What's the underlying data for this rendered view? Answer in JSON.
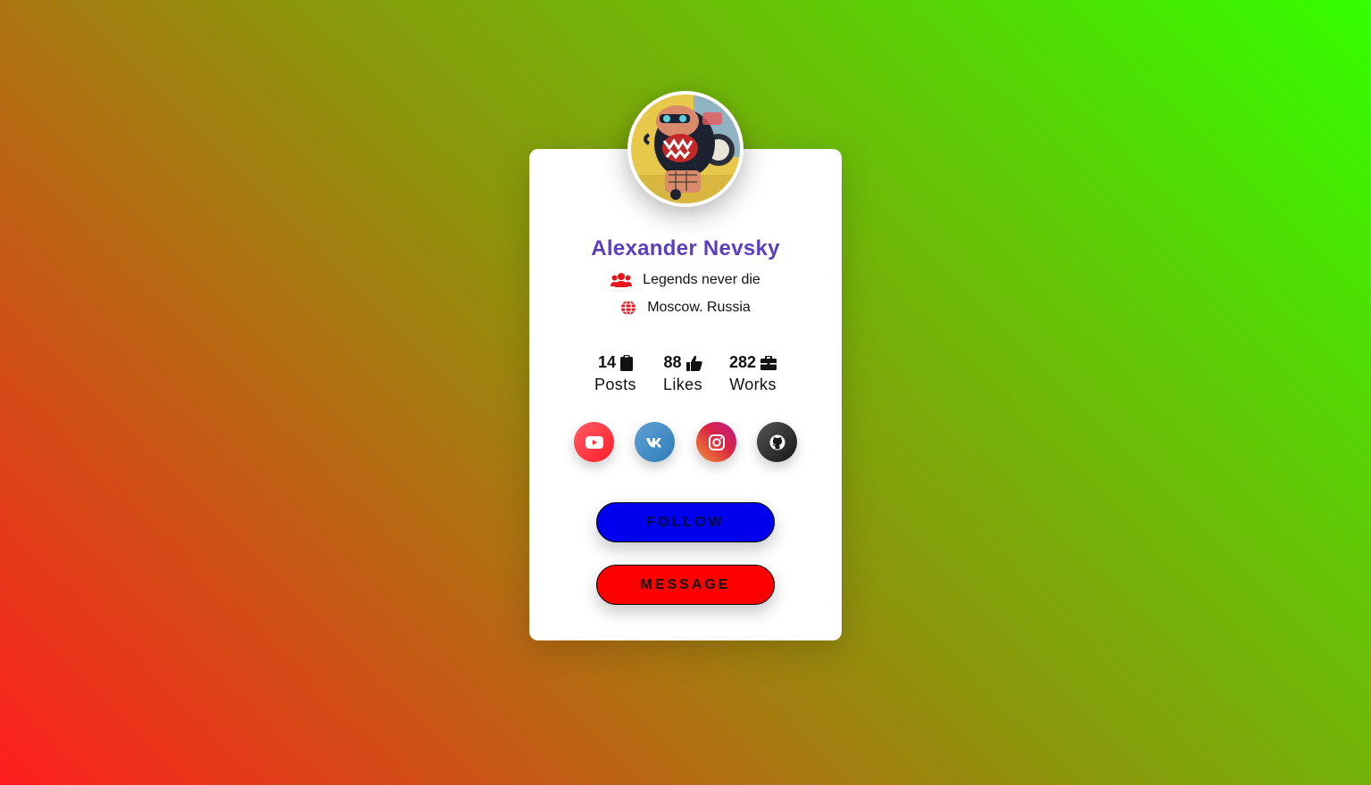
{
  "profile": {
    "name": "Alexander Nevsky",
    "tagline": "Legends never die",
    "location": "Moscow. Russia",
    "avatar_icon": "illustrated-creature-avatar"
  },
  "stats": [
    {
      "value": "14",
      "label": "Posts",
      "icon": "clipboard-icon"
    },
    {
      "value": "88",
      "label": "Likes",
      "icon": "thumbs-up-icon"
    },
    {
      "value": "282",
      "label": "Works",
      "icon": "briefcase-icon"
    }
  ],
  "socials": [
    {
      "name": "youtube",
      "icon": "youtube-icon",
      "color": "#ff2b36"
    },
    {
      "name": "vk",
      "icon": "vk-icon",
      "color": "#4a8fc7"
    },
    {
      "name": "instagram",
      "icon": "instagram-icon",
      "color": "#dc2743"
    },
    {
      "name": "github",
      "icon": "github-icon",
      "color": "#2a2a2a"
    }
  ],
  "actions": {
    "follow_label": "FOLLOW",
    "message_label": "MESSAGE"
  },
  "colors": {
    "name": "#5a3fc0",
    "icon_accent": "#e8161c",
    "follow_bg": "#0000ee",
    "message_bg": "#ff0000",
    "bg_gradient": [
      "#ff1e1e",
      "#8c960c",
      "#33ff00"
    ]
  }
}
